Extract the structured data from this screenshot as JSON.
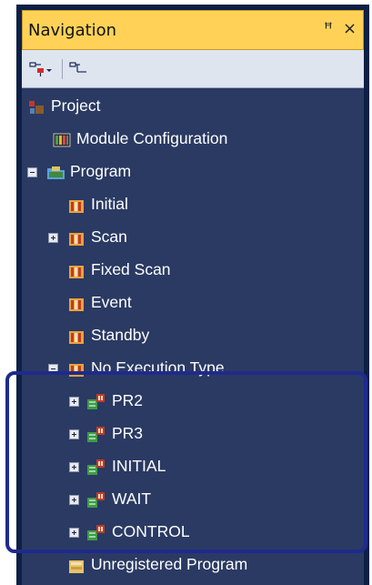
{
  "panel": {
    "title": "Navigation",
    "pin_glyph": "ꟸ",
    "close_glyph": "×"
  },
  "toolbar": {
    "buttons": [
      {
        "icon": "collapse-expand-dropdown-icon"
      },
      {
        "icon": "tree-view-icon"
      }
    ]
  },
  "tree": {
    "project": "Project",
    "module_configuration": "Module Configuration",
    "program": "Program",
    "initial": "Initial",
    "scan": "Scan",
    "fixed_scan": "Fixed Scan",
    "event": "Event",
    "standby": "Standby",
    "no_execution_type": "No Execution Type",
    "pr2": "PR2",
    "pr3": "PR3",
    "initial_caps": "INITIAL",
    "wait": "WAIT",
    "control": "CONTROL",
    "unregistered_program": "Unregistered Program"
  },
  "colors": {
    "titlebar": "#ffd257",
    "tree_bg": "#2a3a63",
    "highlight_border": "#1f2a8c"
  }
}
